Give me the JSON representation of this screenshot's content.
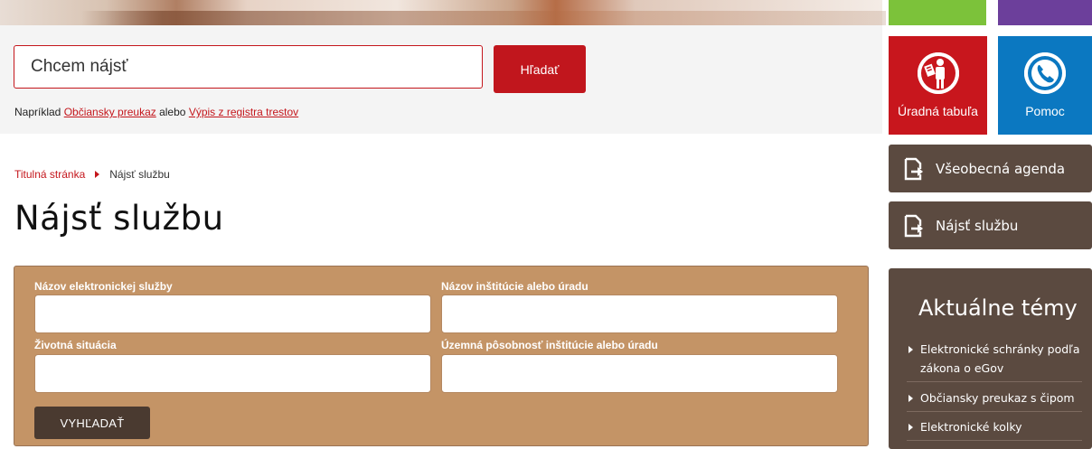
{
  "search": {
    "placeholder": "Chcem nájsť",
    "button_label": "Hľadať",
    "examples_prefix": "Napríklad",
    "example_1": "Občiansky preukaz",
    "examples_or": "alebo",
    "example_2": "Výpis z registra trestov"
  },
  "breadcrumb": {
    "home": "Titulná stránka",
    "current": "Nájsť službu"
  },
  "page": {
    "title": "Nájsť službu"
  },
  "form": {
    "service_name_label": "Názov elektronickej služby",
    "institution_label": "Názov inštitúcie alebo úradu",
    "life_situation_label": "Životná situácia",
    "territorial_label": "Územná pôsobnosť inštitúcie alebo úradu",
    "submit_label": "VYHĽADAŤ"
  },
  "sidebar": {
    "tiles": [
      {
        "label": "Úradná tabuľa",
        "icon": "official-board-icon",
        "color": "#c8161d"
      },
      {
        "label": "Pomoc",
        "icon": "phone-icon",
        "color": "#0b78c1"
      }
    ],
    "top_tile_colors": [
      "#7cc23a",
      "#6c3f9b"
    ],
    "nav": [
      {
        "label": "Všeobecná agenda",
        "icon": "document-arrow-icon"
      },
      {
        "label": "Nájsť službu",
        "icon": "document-arrow-icon"
      }
    ],
    "topics_title": "Aktuálne témy",
    "topics": [
      "Elektronické schránky podľa zákona o eGov",
      "Občiansky preukaz s čipom",
      "Elektronické kolky"
    ]
  },
  "colors": {
    "accent": "#c4161c",
    "form_bg": "#c49466",
    "sidebar_brown": "#5b4a40"
  }
}
